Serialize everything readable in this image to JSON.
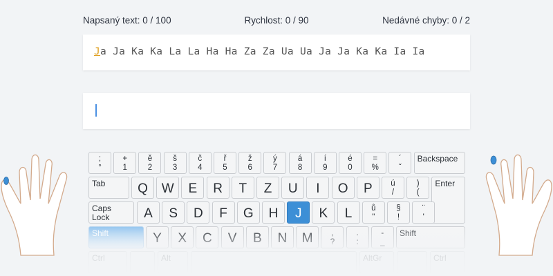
{
  "stats": {
    "typed": "Napsaný text: 0 / 100",
    "speed": "Rychlost: 0 / 90",
    "errors": "Nedávné chyby: 0 / 2"
  },
  "lesson": {
    "current_char": "J",
    "rest": "a Ja Ka Ka La La Ha Ha Za Za Ua Ua Ja Ja Ka Ka Ia Ia"
  },
  "input": {
    "value": ""
  },
  "keyboard": {
    "row1": [
      {
        "top": ";",
        "bottom": "°"
      },
      {
        "top": "+",
        "bottom": "1"
      },
      {
        "top": "ě",
        "bottom": "2"
      },
      {
        "top": "š",
        "bottom": "3"
      },
      {
        "top": "č",
        "bottom": "4"
      },
      {
        "top": "ř",
        "bottom": "5"
      },
      {
        "top": "ž",
        "bottom": "6"
      },
      {
        "top": "ý",
        "bottom": "7"
      },
      {
        "top": "á",
        "bottom": "8"
      },
      {
        "top": "í",
        "bottom": "9"
      },
      {
        "top": "é",
        "bottom": "0"
      },
      {
        "top": "=",
        "bottom": "%"
      },
      {
        "top": "´",
        "bottom": "ˇ"
      }
    ],
    "backspace": "Backspace",
    "tab": "Tab",
    "row2": [
      "Q",
      "W",
      "E",
      "R",
      "T",
      "Z",
      "U",
      "I",
      "O",
      "P"
    ],
    "row2_extra": [
      {
        "top": "ú",
        "bottom": "/"
      },
      {
        "top": ")",
        "bottom": "("
      }
    ],
    "enter": "Enter",
    "caps_line1": "Caps",
    "caps_line2": "Lock",
    "row3": [
      "A",
      "S",
      "D",
      "F",
      "G",
      "H",
      "J",
      "K",
      "L"
    ],
    "row3_extra": [
      {
        "top": "ů",
        "bottom": "\""
      },
      {
        "top": "§",
        "bottom": "!"
      },
      {
        "top": "¨",
        "bottom": "'"
      }
    ],
    "shift_left": "Shift",
    "row4": [
      "Y",
      "X",
      "C",
      "V",
      "B",
      "N",
      "M"
    ],
    "row4_extra": [
      {
        "top": ",",
        "bottom": "?"
      },
      {
        "top": ".",
        "bottom": ":"
      },
      {
        "top": "-",
        "bottom": "_"
      }
    ],
    "shift_right": "Shift",
    "ctrl_left": "Ctrl",
    "alt_left": "Alt",
    "altgr": "AltGr",
    "ctrl_right": "Ctrl",
    "highlighted_key": "J",
    "highlight_color": "#3d8fd6"
  },
  "hands": {
    "active_finger_color": "#3d8fd6"
  }
}
